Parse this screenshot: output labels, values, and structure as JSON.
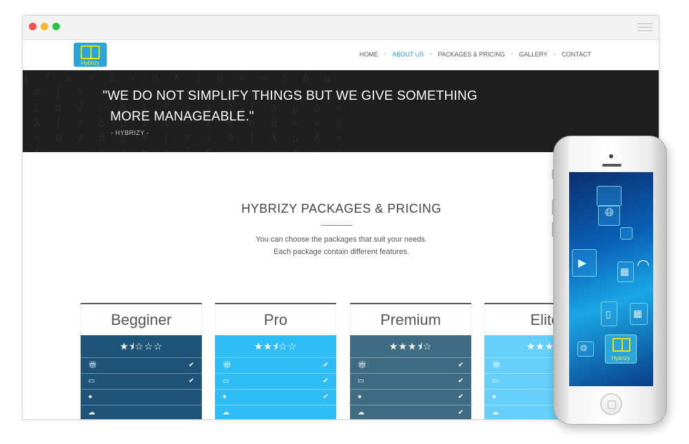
{
  "nav": {
    "items": [
      {
        "label": "HOME",
        "active": false
      },
      {
        "label": "ABOUT US",
        "active": true
      },
      {
        "label": "PACKAGES & PRICING",
        "active": false
      },
      {
        "label": "GALLERY",
        "active": false
      },
      {
        "label": "CONTACT",
        "active": false
      }
    ]
  },
  "logo": {
    "text": "Hybrizy"
  },
  "hero": {
    "quote_line1": "\"WE DO NOT SIMPLIFY THINGS BUT WE GIVE SOMETHING",
    "quote_line2": "MORE MANAGEABLE.\"",
    "author": "- HYBRIZY -"
  },
  "pricing": {
    "title": "HYBRIZY PACKAGES & PRICING",
    "desc_line1": "You can choose the packages that suit your needs.",
    "desc_line2": "Each package contain different features.",
    "plans": [
      {
        "name": "Begginer",
        "stars": "★⯨☆☆☆",
        "rating": 1.5,
        "color": "#1d5478",
        "checks": [
          true,
          true,
          false,
          false
        ]
      },
      {
        "name": "Pro",
        "stars": "★★⯨☆☆",
        "rating": 2.5,
        "color": "#2ebdf5",
        "checks": [
          true,
          true,
          true,
          false
        ]
      },
      {
        "name": "Premium",
        "stars": "★★★⯨☆",
        "rating": 3.5,
        "color": "#3f6c82",
        "checks": [
          true,
          true,
          true,
          true
        ]
      },
      {
        "name": "Elite",
        "stars": "★★★★",
        "rating": 4,
        "color": "#66d0fb",
        "checks": [
          true,
          true,
          true,
          true
        ]
      }
    ],
    "feature_icons": [
      "gift-icon",
      "inbox-icon",
      "globe-icon",
      "cloud-upload-icon"
    ]
  },
  "phone": {
    "app_label": "Hybrizy"
  },
  "colors": {
    "accent": "#2a9fd8",
    "hero_bg": "#1f1f1f"
  }
}
